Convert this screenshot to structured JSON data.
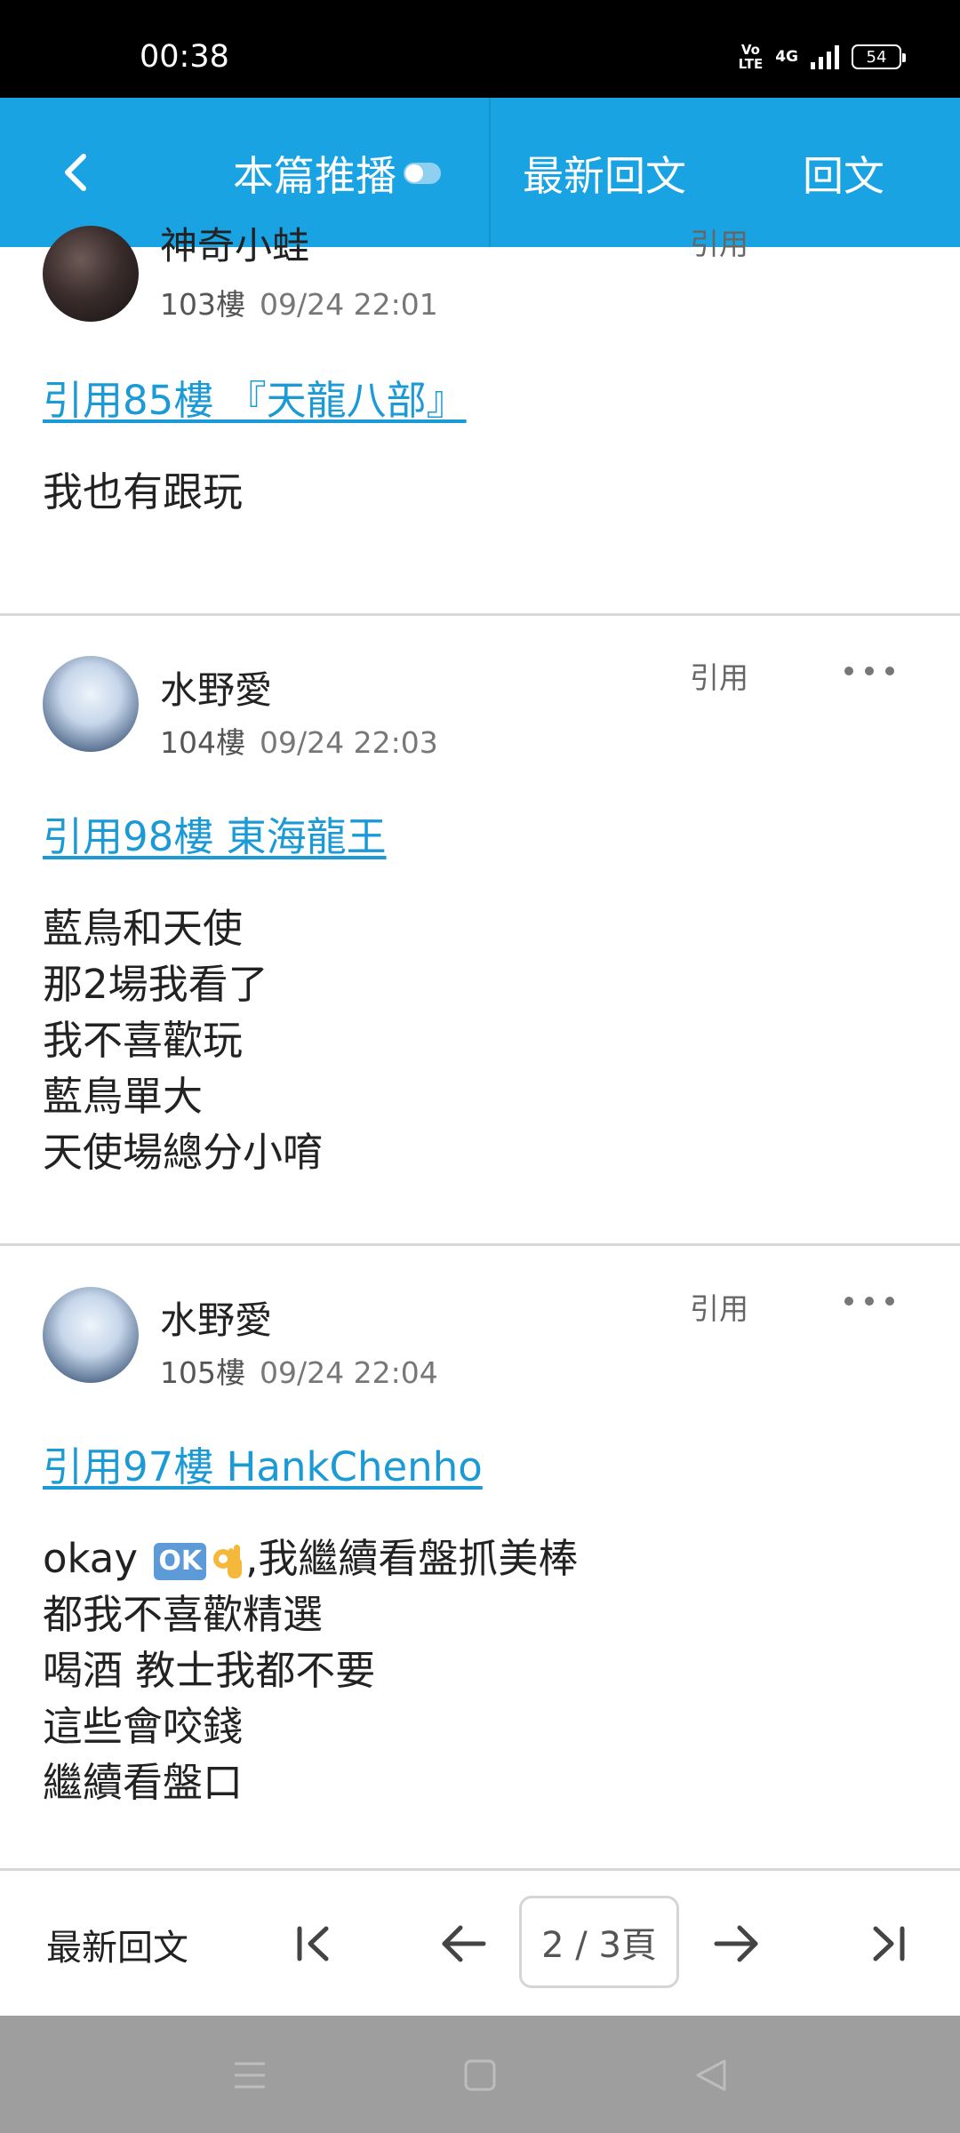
{
  "status_bar": {
    "time": "00:38",
    "volte_line1": "Vo",
    "volte_line2": "LTE",
    "network": "4G",
    "battery": "54"
  },
  "nav": {
    "back_icon": "chevron-left-icon",
    "push_label": "本篇推播",
    "latest_label": "最新回文",
    "reply_label": "回文",
    "background_color": "#1aa3e3"
  },
  "posts": [
    {
      "author": "神奇小蛙",
      "floor": "103樓",
      "time": "09/24 22:01",
      "quote_label": "引用",
      "quote_link": "引用85樓 『天龍八部』",
      "lines": [
        "我也有跟玩"
      ]
    },
    {
      "author": "水野愛",
      "floor": "104樓",
      "time": "09/24 22:03",
      "quote_label": "引用",
      "quote_link": "引用98樓 東海龍王",
      "lines": [
        "藍鳥和天使",
        "那2場我看了",
        "我不喜歡玩",
        "藍鳥單大",
        "天使場總分小唷"
      ]
    },
    {
      "author": "水野愛",
      "floor": "105樓",
      "time": "09/24 22:04",
      "quote_label": "引用",
      "quote_link": "引用97樓 HankChenho",
      "lines": [
        "okay",
        "OK",
        ",我繼續看盤抓美棒",
        "都我不喜歡精選",
        "喝酒 教士我都不要",
        "這些會咬錢",
        "繼續看盤口"
      ]
    }
  ],
  "pager": {
    "latest_label": "最新回文",
    "page_indicator": "2 / 3頁"
  },
  "accent_color": "#1b9ad6"
}
